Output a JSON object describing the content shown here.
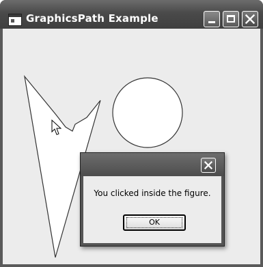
{
  "window": {
    "title": "GraphicsPath Example",
    "controls": [
      "minimize",
      "maximize",
      "close"
    ]
  },
  "canvas": {
    "shapes": [
      "polygon-figure",
      "circle"
    ],
    "cursor": "arrow-cursor"
  },
  "message_box": {
    "message": "You clicked inside the figure.",
    "ok_label": "OK"
  }
}
